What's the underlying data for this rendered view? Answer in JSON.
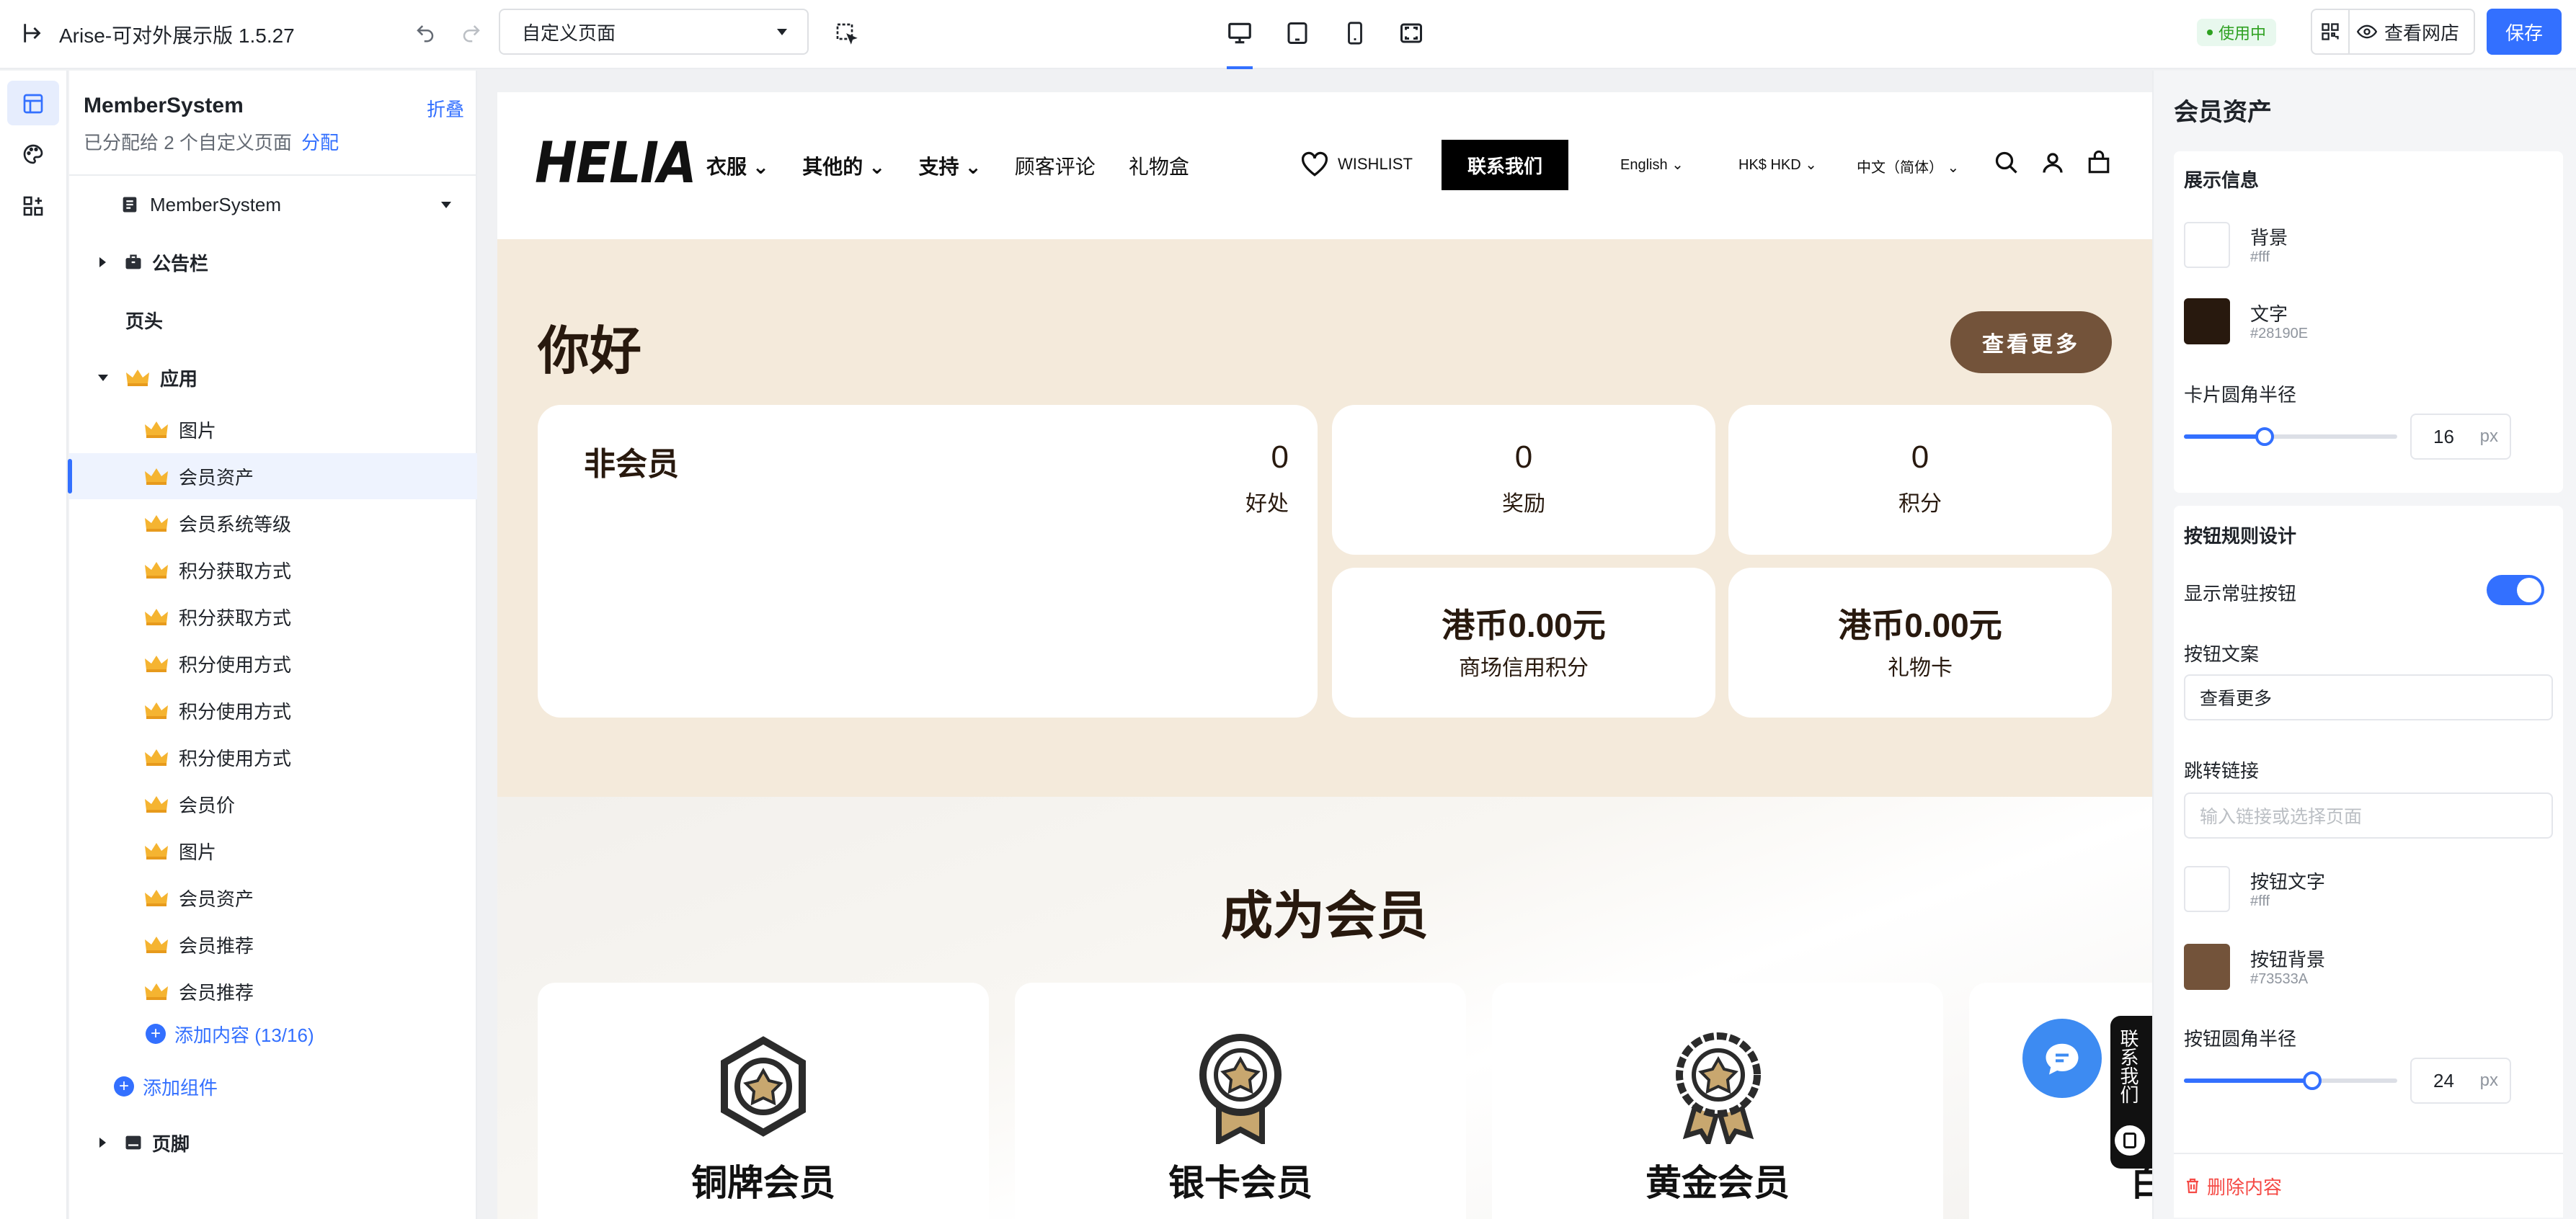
{
  "app": {
    "title": "Arise-可对外展示版 1.5.27",
    "page_select": "自定义页面",
    "status_badge": "使用中",
    "view_store": "查看网店",
    "save": "保存"
  },
  "tree": {
    "title": "MemberSystem",
    "collapse": "折叠",
    "assigned_prefix": "已分配给 2 个自定义页面",
    "assign_link": "分配",
    "template_select": "MemberSystem",
    "announcement": "公告栏",
    "header": "页头",
    "apps": "应用",
    "items": [
      "图片",
      "会员资产",
      "会员系统等级",
      "积分获取方式",
      "积分获取方式",
      "积分使用方式",
      "积分使用方式",
      "积分使用方式",
      "会员价",
      "图片",
      "会员资产",
      "会员推荐",
      "会员推荐"
    ],
    "add_content": "添加内容 (13/16)",
    "add_component": "添加组件",
    "footer": "页脚"
  },
  "store": {
    "logo": "HELIA",
    "nav": [
      "衣服",
      "其他的",
      "支持",
      "顾客评论",
      "礼物盒"
    ],
    "wishlist": "WISHLIST",
    "contact": "联系我们",
    "lang": "English",
    "currency": "HK$ HKD",
    "region": "中文（简体）",
    "greeting": "你好",
    "view_more": "查看更多",
    "status": "非会员",
    "stats": [
      {
        "value": "0",
        "label": "好处"
      },
      {
        "value": "0",
        "label": "奖励"
      },
      {
        "value": "0",
        "label": "积分"
      },
      {
        "value": "港币0.00元",
        "label": "商场信用积分"
      },
      {
        "value": "港币0.00元",
        "label": "礼物卡"
      }
    ],
    "become_member": "成为会员",
    "tiers": [
      "铜牌会员",
      "银卡会员",
      "黄金会员",
      "白"
    ],
    "side_contact": "联系我们"
  },
  "props": {
    "title": "会员资产",
    "section_display": "展示信息",
    "bg_label": "背景",
    "bg_value": "#fff",
    "text_label": "文字",
    "text_value": "#28190E",
    "card_radius_label": "卡片圆角半径",
    "card_radius": "16",
    "card_radius_fraction": 0.38,
    "section_button": "按钮规则设计",
    "show_button_label": "显示常驻按钮",
    "button_text_label": "按钮文案",
    "button_text": "查看更多",
    "link_label": "跳转链接",
    "link_placeholder": "输入链接或选择页面",
    "btn_text_color_label": "按钮文字",
    "btn_text_color": "#fff",
    "btn_bg_label": "按钮背景",
    "btn_bg_color": "#73533A",
    "btn_radius_label": "按钮圆角半径",
    "btn_radius": "24",
    "btn_radius_fraction": 0.6,
    "unit": "px",
    "delete": "删除内容"
  },
  "colors": {
    "accent": "#3370ff",
    "brand_brown": "#73533A",
    "text_dark": "#28190E",
    "hero_bg": "#f4eadb"
  }
}
